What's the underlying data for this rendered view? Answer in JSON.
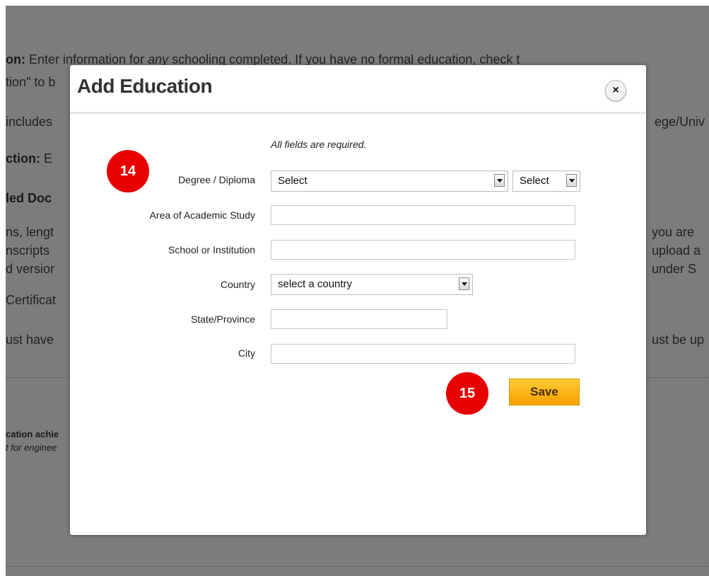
{
  "background": {
    "line1_bold": "on:",
    "line1_a": " Enter information for ",
    "line1_em": "any",
    "line1_b": " schooling completed. If you have no formal education, check t",
    "line2": "tion\" to b",
    "line3_left": " includes",
    "line3_right": "ege/Univ",
    "line4_bold": "ction:",
    "line4_rest": " E",
    "line5_bold": "led Doc",
    "line6_left": "ns, lengt",
    "line6_right": "you are",
    "line7_left": "nscripts",
    "line7_right": "upload a",
    "line8_left": "d versior",
    "line8_right": "under S",
    "line9_left": "Certificat",
    "line10_left": "ust have",
    "line10_right": "ust be up",
    "small1": "cation achie",
    "small2": "t for enginee"
  },
  "modal": {
    "title": "Add Education",
    "close_glyph": "×",
    "required_note": "All fields are required."
  },
  "form": {
    "degree_label": "Degree / Diploma",
    "degree_select_value": "Select",
    "degree_select2_value": "Select",
    "study_label": "Area of Academic Study",
    "study_value": "",
    "school_label": "School or Institution",
    "school_value": "",
    "country_label": "Country",
    "country_select_value": "select a country",
    "state_label": "State/Province",
    "state_value": "",
    "city_label": "City",
    "city_value": "",
    "save_label": "Save"
  },
  "badges": {
    "step1": "14",
    "step2": "15"
  },
  "colors": {
    "overlay": "#7c7c7c",
    "badge": "#e80000",
    "save_button": "#f7a000"
  }
}
